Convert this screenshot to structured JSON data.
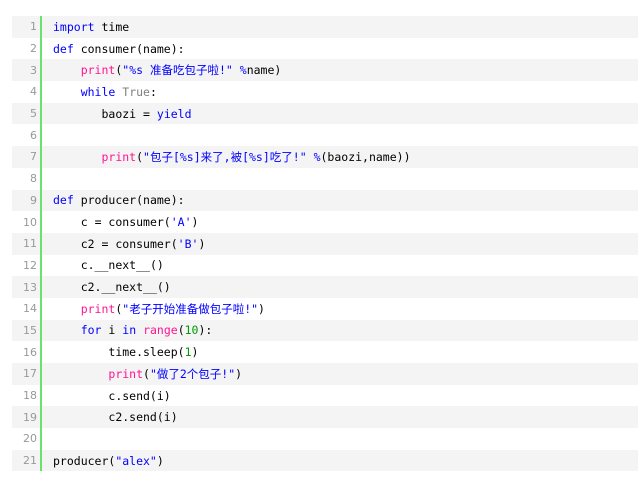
{
  "colors": {
    "keyword": "#0000ff",
    "builtin": "#ff1493",
    "string": "#0000ff",
    "number": "#009900",
    "gutter_border": "#6ce26c",
    "line_number": "#999999"
  },
  "lines": [
    {
      "n": "1",
      "indent": "",
      "tokens": [
        {
          "t": "import",
          "c": "kw"
        },
        {
          "t": " time",
          "c": "tx"
        }
      ]
    },
    {
      "n": "2",
      "indent": "",
      "tokens": [
        {
          "t": "def",
          "c": "kw"
        },
        {
          "t": " consumer(name):",
          "c": "tx"
        }
      ]
    },
    {
      "n": "3",
      "indent": "    ",
      "tokens": [
        {
          "t": "print",
          "c": "fn"
        },
        {
          "t": "(",
          "c": "tx"
        },
        {
          "t": "\"%s 准备吃包子啦!\"",
          "c": "st"
        },
        {
          "t": " ",
          "c": "tx"
        },
        {
          "t": "%",
          "c": "st"
        },
        {
          "t": "name)",
          "c": "tx"
        }
      ]
    },
    {
      "n": "4",
      "indent": "    ",
      "tokens": [
        {
          "t": "while",
          "c": "kw"
        },
        {
          "t": " ",
          "c": "tx"
        },
        {
          "t": "True",
          "c": "gr"
        },
        {
          "t": ":",
          "c": "tx"
        }
      ]
    },
    {
      "n": "5",
      "indent": "       ",
      "tokens": [
        {
          "t": "baozi ",
          "c": "tx"
        },
        {
          "t": "=",
          "c": "tx"
        },
        {
          "t": " ",
          "c": "tx"
        },
        {
          "t": "yield",
          "c": "kw"
        }
      ]
    },
    {
      "n": "6",
      "indent": "",
      "tokens": []
    },
    {
      "n": "7",
      "indent": "       ",
      "tokens": [
        {
          "t": "print",
          "c": "fn"
        },
        {
          "t": "(",
          "c": "tx"
        },
        {
          "t": "\"包子[%s]来了,被[%s]吃了!\"",
          "c": "st"
        },
        {
          "t": " ",
          "c": "tx"
        },
        {
          "t": "%",
          "c": "st"
        },
        {
          "t": "(baozi,name))",
          "c": "tx"
        }
      ]
    },
    {
      "n": "8",
      "indent": "",
      "tokens": []
    },
    {
      "n": "9",
      "indent": "",
      "tokens": [
        {
          "t": "def",
          "c": "kw"
        },
        {
          "t": " producer(name):",
          "c": "tx"
        }
      ]
    },
    {
      "n": "10",
      "indent": "    ",
      "tokens": [
        {
          "t": "c ",
          "c": "tx"
        },
        {
          "t": "=",
          "c": "tx"
        },
        {
          "t": " consumer(",
          "c": "tx"
        },
        {
          "t": "'A'",
          "c": "st"
        },
        {
          "t": ")",
          "c": "tx"
        }
      ]
    },
    {
      "n": "11",
      "indent": "    ",
      "tokens": [
        {
          "t": "c2 ",
          "c": "tx"
        },
        {
          "t": "=",
          "c": "tx"
        },
        {
          "t": " consumer(",
          "c": "tx"
        },
        {
          "t": "'B'",
          "c": "st"
        },
        {
          "t": ")",
          "c": "tx"
        }
      ]
    },
    {
      "n": "12",
      "indent": "    ",
      "tokens": [
        {
          "t": "c.__next__()",
          "c": "tx"
        }
      ]
    },
    {
      "n": "13",
      "indent": "    ",
      "tokens": [
        {
          "t": "c2.__next__()",
          "c": "tx"
        }
      ]
    },
    {
      "n": "14",
      "indent": "    ",
      "tokens": [
        {
          "t": "print",
          "c": "fn"
        },
        {
          "t": "(",
          "c": "tx"
        },
        {
          "t": "\"老子开始准备做包子啦!\"",
          "c": "st"
        },
        {
          "t": ")",
          "c": "tx"
        }
      ]
    },
    {
      "n": "15",
      "indent": "    ",
      "tokens": [
        {
          "t": "for",
          "c": "kw"
        },
        {
          "t": " i ",
          "c": "tx"
        },
        {
          "t": "in",
          "c": "kw"
        },
        {
          "t": " ",
          "c": "tx"
        },
        {
          "t": "range",
          "c": "fn"
        },
        {
          "t": "(",
          "c": "tx"
        },
        {
          "t": "10",
          "c": "nm"
        },
        {
          "t": "):",
          "c": "tx"
        }
      ]
    },
    {
      "n": "16",
      "indent": "        ",
      "tokens": [
        {
          "t": "time.sleep(",
          "c": "tx"
        },
        {
          "t": "1",
          "c": "nm"
        },
        {
          "t": ")",
          "c": "tx"
        }
      ]
    },
    {
      "n": "17",
      "indent": "        ",
      "tokens": [
        {
          "t": "print",
          "c": "fn"
        },
        {
          "t": "(",
          "c": "tx"
        },
        {
          "t": "\"做了2个包子!\"",
          "c": "st"
        },
        {
          "t": ")",
          "c": "tx"
        }
      ]
    },
    {
      "n": "18",
      "indent": "        ",
      "tokens": [
        {
          "t": "c.send(i)",
          "c": "tx"
        }
      ]
    },
    {
      "n": "19",
      "indent": "        ",
      "tokens": [
        {
          "t": "c2.send(i)",
          "c": "tx"
        }
      ]
    },
    {
      "n": "20",
      "indent": "",
      "tokens": []
    },
    {
      "n": "21",
      "indent": "",
      "tokens": [
        {
          "t": "producer(",
          "c": "tx"
        },
        {
          "t": "\"alex\"",
          "c": "st"
        },
        {
          "t": ")",
          "c": "tx"
        }
      ]
    }
  ]
}
